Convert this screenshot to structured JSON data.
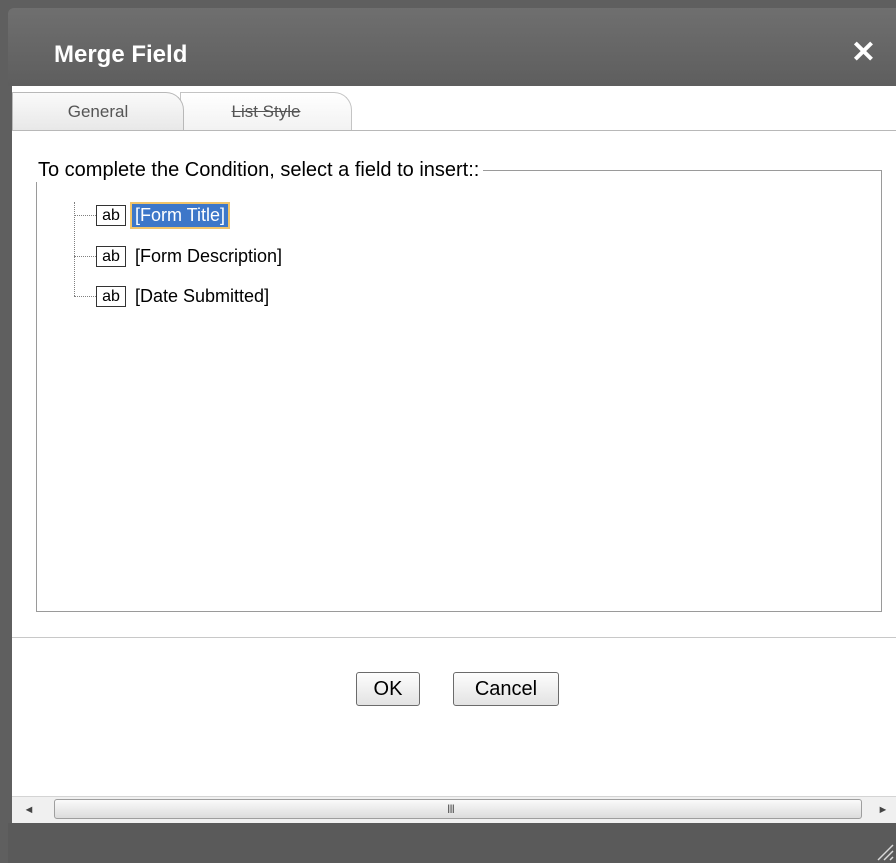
{
  "dialog": {
    "title": "Merge Field",
    "close_symbol": "✕"
  },
  "tabs": [
    {
      "label": "General",
      "active": true
    },
    {
      "label": "List Style",
      "active": false
    }
  ],
  "fieldset": {
    "legend": "To complete the Condition, select a field to insert::"
  },
  "fields": [
    {
      "icon_text": "ab",
      "label": "[Form Title]",
      "selected": true
    },
    {
      "icon_text": "ab",
      "label": "[Form Description]",
      "selected": false
    },
    {
      "icon_text": "ab",
      "label": "[Date Submitted]",
      "selected": false
    }
  ],
  "buttons": {
    "ok_label": "OK",
    "cancel_label": "Cancel"
  },
  "scrollbar": {
    "left_arrow": "◄",
    "right_arrow": "►",
    "grip": "III"
  },
  "colors": {
    "titlebar": "#666666",
    "selection": "#3d77c9",
    "selection_outline": "#f1c46a"
  },
  "icons": [
    "close-icon",
    "text-field-icon",
    "resize-grip-icon",
    "scroll-left-icon",
    "scroll-right-icon"
  ]
}
